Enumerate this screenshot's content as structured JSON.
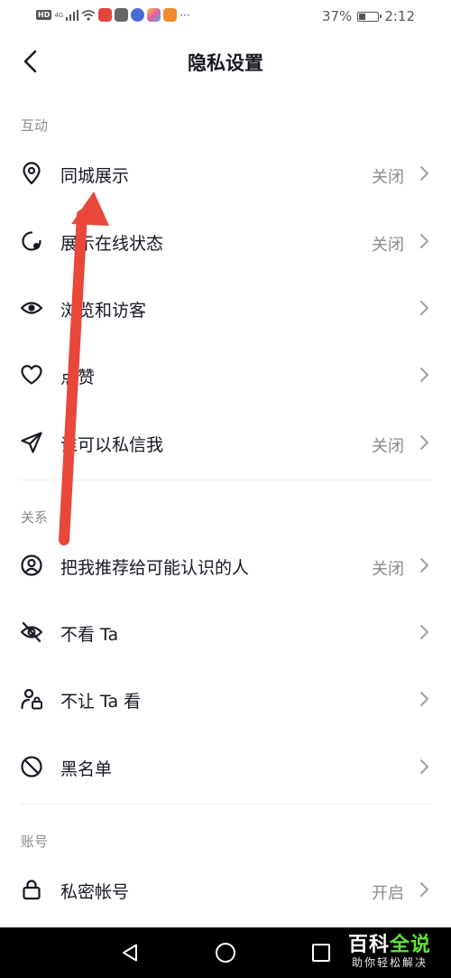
{
  "status_bar": {
    "hd": "HD",
    "network": "4G",
    "battery_text": "37%",
    "battery_level": 0.37,
    "time": "2:12",
    "more": "···"
  },
  "header": {
    "title": "隐私设置",
    "back_icon": "chevron-left-icon"
  },
  "sections": [
    {
      "label": "互动",
      "items": [
        {
          "label": "同城展示",
          "value": "关闭",
          "icon": "location-pin-icon"
        },
        {
          "label": "展示在线状态",
          "value": "关闭",
          "icon": "online-status-icon"
        },
        {
          "label": "浏览和访客",
          "value": "",
          "icon": "eye-icon"
        },
        {
          "label": "点赞",
          "value": "",
          "icon": "heart-icon"
        },
        {
          "label": "谁可以私信我",
          "value": "关闭",
          "icon": "paper-plane-icon"
        }
      ]
    },
    {
      "label": "关系",
      "items": [
        {
          "label": "把我推荐给可能认识的人",
          "value": "关闭",
          "icon": "user-circle-icon"
        },
        {
          "label": "不看 Ta",
          "value": "",
          "icon": "eye-off-icon"
        },
        {
          "label": "不让 Ta 看",
          "value": "",
          "icon": "user-lock-icon"
        },
        {
          "label": "黑名单",
          "value": "",
          "icon": "block-icon"
        }
      ]
    },
    {
      "label": "账号",
      "items": [
        {
          "label": "私密帐号",
          "value": "开启",
          "icon": "lock-icon"
        }
      ]
    }
  ],
  "nav_bar": {
    "back": "triangle-back-icon",
    "home": "circle-home-icon",
    "recents": "square-recents-icon"
  },
  "watermark": {
    "title_white": "百科",
    "title_green": "全说",
    "subtitle": "助你轻松解决"
  },
  "colors": {
    "text": "#161823",
    "secondary": "#8a8b91",
    "arrow": "#e8473a",
    "divider": "#ededee"
  }
}
